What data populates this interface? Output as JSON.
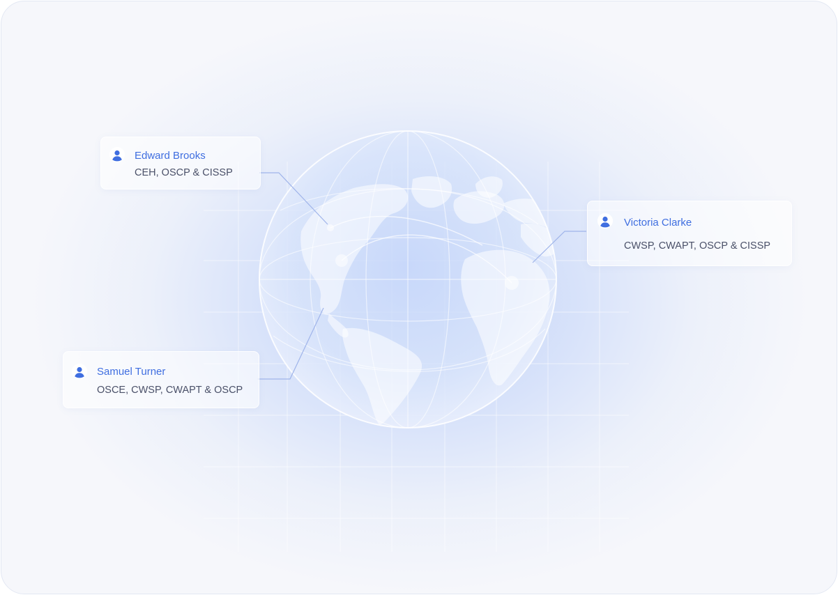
{
  "colors": {
    "accent": "#3f6ee0",
    "text_secondary": "#4a5068",
    "connector": "#9fb4ea"
  },
  "experts": [
    {
      "name": "Edward Brooks",
      "certifications": "CEH, OSCP & CISSP",
      "icon": "user-icon"
    },
    {
      "name": "Victoria Clarke",
      "certifications": "CWSP, CWAPT, OSCP & CISSP",
      "icon": "user-icon"
    },
    {
      "name": "Samuel Turner",
      "certifications": "OSCE, CWSP, CWAPT & OSCP",
      "icon": "user-icon"
    }
  ]
}
